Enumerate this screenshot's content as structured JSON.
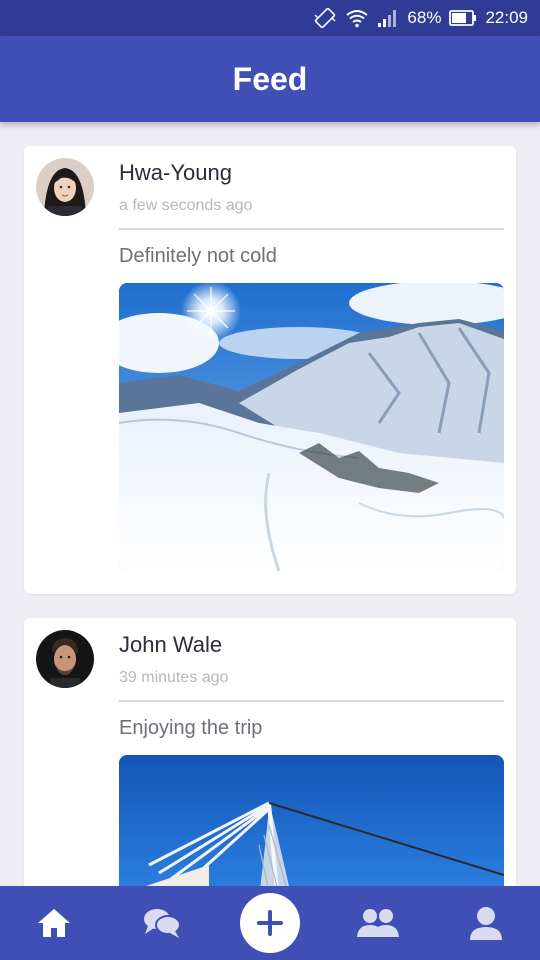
{
  "status_bar": {
    "battery_percent": "68%",
    "time": "22:09"
  },
  "header": {
    "title": "Feed"
  },
  "posts": [
    {
      "author": "Hwa-Young",
      "time": "a few seconds ago",
      "caption": "Definitely not cold",
      "image_icon": "snowy-mountains-photo"
    },
    {
      "author": "John Wale",
      "time": "39 minutes ago",
      "caption": "Enjoying the trip",
      "image_icon": "bridge-photo"
    }
  ],
  "bottom_nav": {
    "items": [
      "home-icon",
      "chat-icon",
      "add-icon",
      "group-icon",
      "profile-icon"
    ]
  },
  "colors": {
    "primary": "#3f4fb5",
    "status_bar": "#2f3b94",
    "background": "#eeedf3"
  }
}
